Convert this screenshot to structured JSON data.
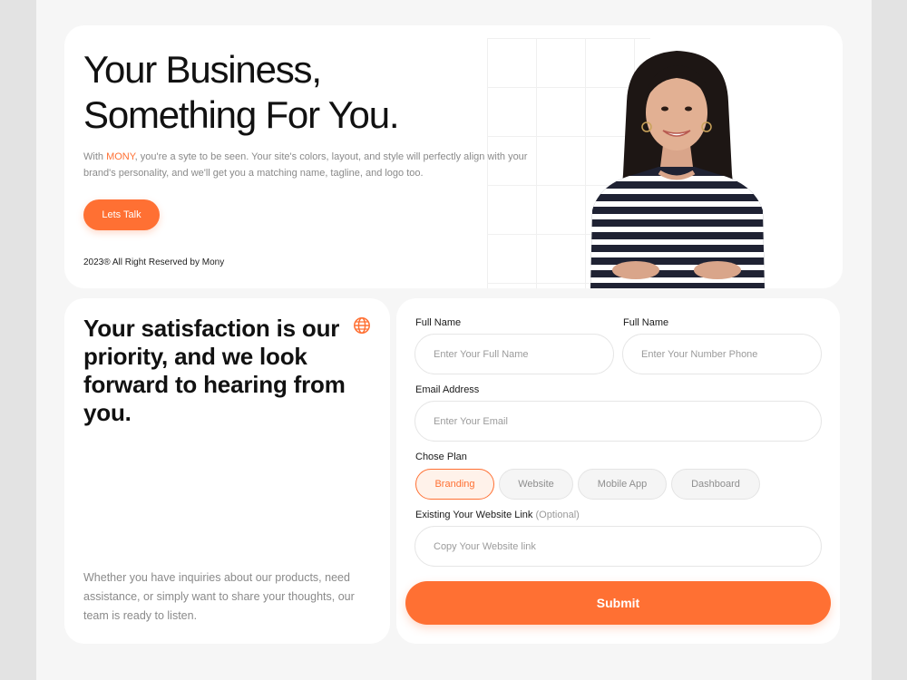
{
  "hero": {
    "title": "Your Business,\nSomething For You.",
    "desc_prefix": "With ",
    "brand": "MONY",
    "desc_suffix": ", you're a syte to be seen. Your site's colors, layout, and style will perfectly align with your brand's personality, and we'll get you a matching name, tagline, and logo too.",
    "cta_label": "Lets Talk",
    "copyright": "2023® All Right Reserved by Mony"
  },
  "info": {
    "title": "Your satisfaction is our priority, and we look forward to hearing from you.",
    "icon": "globe-icon",
    "description": "Whether you have inquiries about our products, need assistance, or simply want to share your thoughts, our team is ready to listen."
  },
  "form": {
    "full_name_label": "Full Name",
    "full_name_placeholder": "Enter Your Full Name",
    "phone_label": "Full Name",
    "phone_placeholder": "Enter Your Number Phone",
    "email_label": "Email Address",
    "email_placeholder": "Enter Your Email",
    "plan_label": "Chose Plan",
    "plans": [
      "Branding",
      "Website",
      "Mobile App",
      "Dashboard"
    ],
    "selected_plan": "Branding",
    "website_label": "Existing Your Website Link",
    "website_optional": "(Optional)",
    "website_placeholder": "Copy Your Website link",
    "submit_label": "Submit"
  },
  "colors": {
    "accent": "#ff7033",
    "page_bg": "#f6f6f6",
    "card_bg": "#ffffff"
  }
}
